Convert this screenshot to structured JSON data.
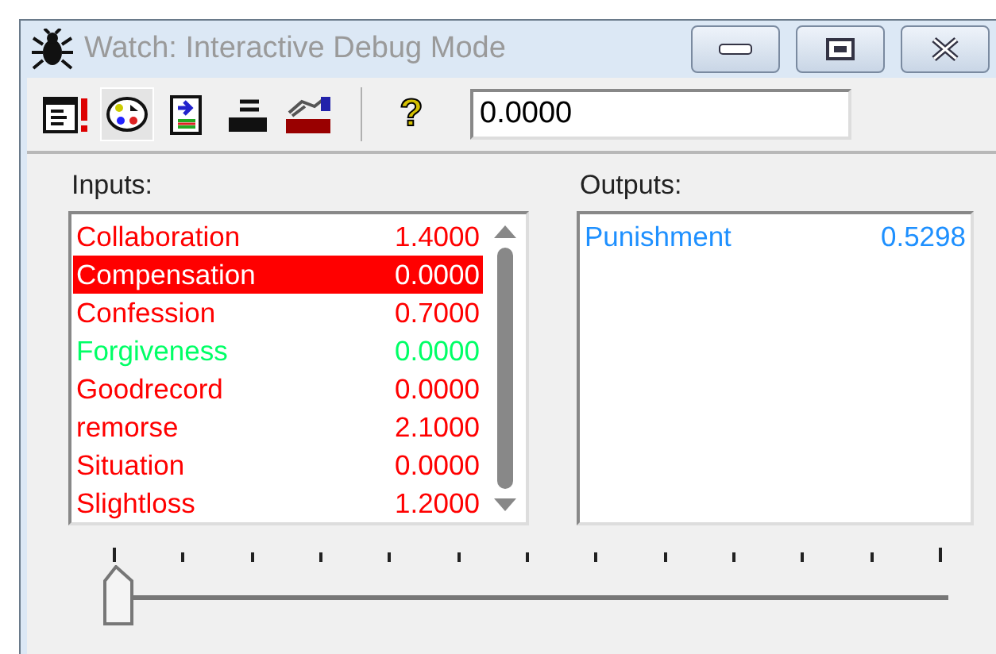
{
  "window": {
    "title": "Watch: Interactive Debug Mode"
  },
  "toolbar": {
    "value": "0.0000",
    "help": "?"
  },
  "inputs": {
    "label": "Inputs:",
    "items": [
      {
        "name": "Collaboration",
        "value": "1.4000",
        "color": "#ff0000",
        "selected": false
      },
      {
        "name": "Compensation",
        "value": "0.0000",
        "color": "#ff0000",
        "selected": true
      },
      {
        "name": "Confession",
        "value": "0.7000",
        "color": "#ff0000",
        "selected": false
      },
      {
        "name": "Forgiveness",
        "value": "0.0000",
        "color": "#00ff66",
        "selected": false
      },
      {
        "name": "Goodrecord",
        "value": "0.0000",
        "color": "#ff0000",
        "selected": false
      },
      {
        "name": "remorse",
        "value": "2.1000",
        "color": "#ff0000",
        "selected": false
      },
      {
        "name": "Situation",
        "value": "0.0000",
        "color": "#ff0000",
        "selected": false
      },
      {
        "name": "Slightloss",
        "value": "1.2000",
        "color": "#ff0000",
        "selected": false
      }
    ]
  },
  "outputs": {
    "label": "Outputs:",
    "items": [
      {
        "name": "Punishment",
        "value": "0.5298",
        "color": "#1e90ff",
        "selected": false
      }
    ]
  },
  "slider": {
    "level": 0
  }
}
